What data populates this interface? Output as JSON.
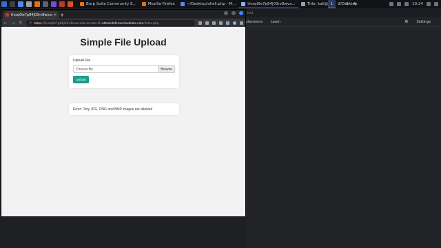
{
  "panel": {
    "taskbar_items": [
      {
        "label": "Burp Suite Community E...",
        "color": "#e8710a"
      },
      {
        "label": "Mozilla Firefox",
        "color": "#e8710a"
      },
      {
        "label": "~/Desktop/shell.php - M...",
        "color": "#4c8bf5"
      },
      {
        "label": "tivsq0le7p84j03rv8wvx...",
        "color": "#8ab4f8",
        "active": true
      },
      {
        "label": "Title: kali@kali: ~/Desktop",
        "color": "#9aa0a6"
      }
    ],
    "workspaces": [
      "1",
      "2",
      "3",
      "4"
    ],
    "current_workspace": "1",
    "clock": "10:24"
  },
  "browser": {
    "tab_title": "tivsq0le7p84j03rv8wvxcc...",
    "new_tab": "+",
    "url_warning": "⚠",
    "url_proto": "https",
    "url_rest": "://tivsq0le7p84j03rv8wvxcxda.us-east-40.",
    "url_host": "attackdefensecloudlabs.com",
    "url_path": "/index.php",
    "nav": {
      "back": "←",
      "forward": "→",
      "reload": "↻"
    }
  },
  "page": {
    "title": "Simple File Upload",
    "upload_label": "Upload File",
    "file_placeholder": "Choose file",
    "browse_label": "Browse",
    "upload_button": "Upload",
    "error_message": "Error! Only JPG, PNG and BMP images are allowed"
  },
  "right_window": {
    "top_text": "lect",
    "menu": [
      "xtensions",
      "Learn"
    ],
    "settings_label": "Settings"
  }
}
